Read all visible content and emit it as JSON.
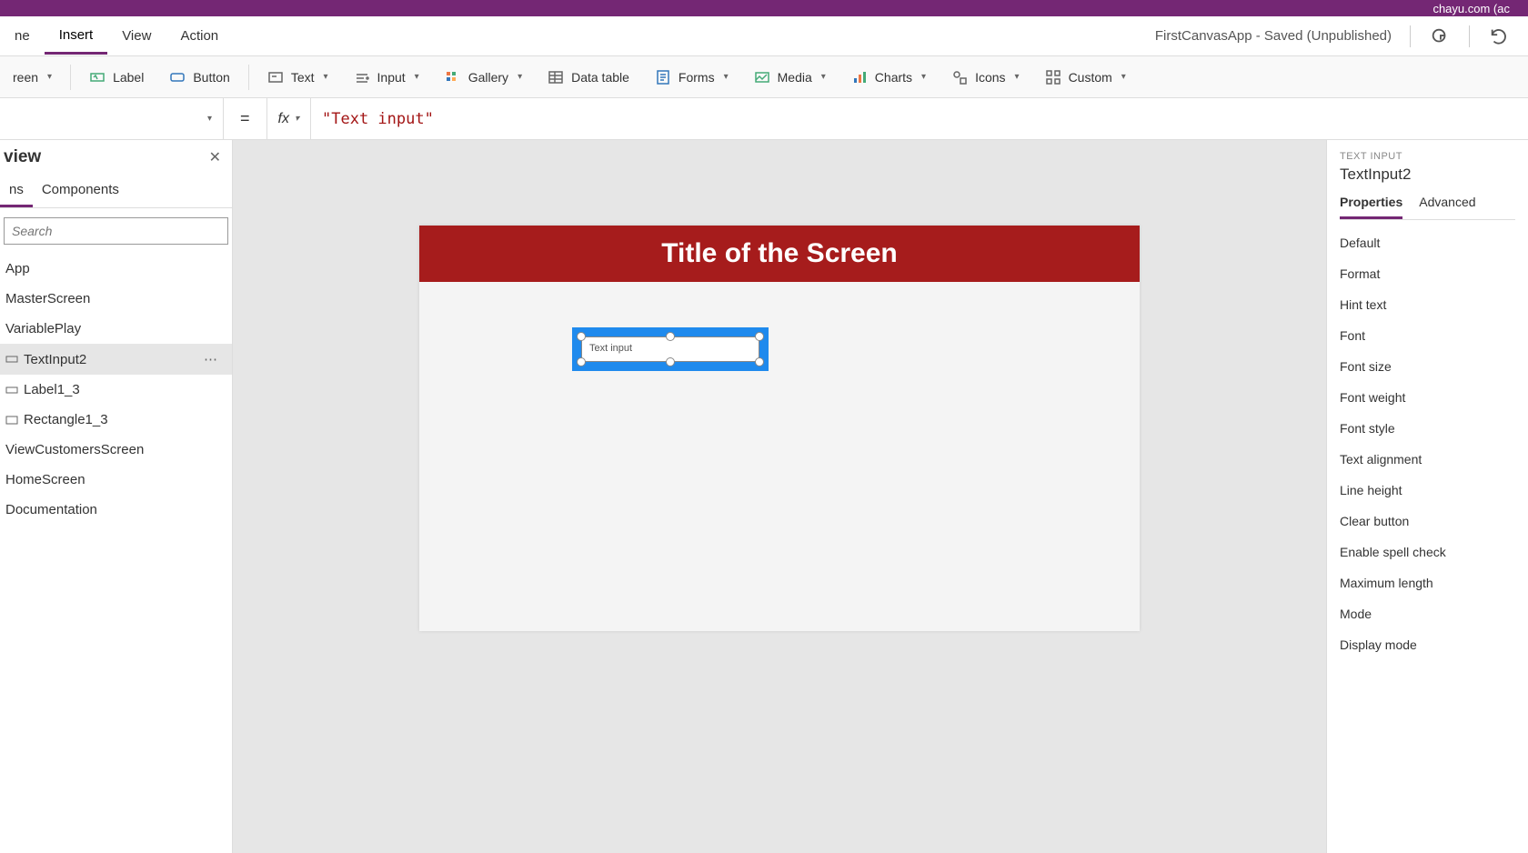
{
  "title_bar": {
    "user_text": "chayu.com (ac"
  },
  "menu": {
    "items": [
      "ne",
      "Insert",
      "View",
      "Action"
    ],
    "active_index": 1,
    "status": "FirstCanvasApp - Saved (Unpublished)"
  },
  "ribbon": {
    "screen": "reen",
    "label": "Label",
    "button": "Button",
    "text": "Text",
    "input": "Input",
    "gallery": "Gallery",
    "datatable": "Data table",
    "forms": "Forms",
    "media": "Media",
    "charts": "Charts",
    "icons": "Icons",
    "custom": "Custom"
  },
  "formula": {
    "equals": "=",
    "fx": "fx",
    "value": "\"Text input\""
  },
  "tree": {
    "title": "view",
    "tabs": [
      "ns",
      "Components"
    ],
    "active_tab": 0,
    "search_placeholder": "Search",
    "items": [
      {
        "label": "App"
      },
      {
        "label": "MasterScreen"
      },
      {
        "label": "VariablePlay"
      },
      {
        "label": "TextInput2",
        "selected": true
      },
      {
        "label": "Label1_3"
      },
      {
        "label": "Rectangle1_3"
      },
      {
        "label": "ViewCustomersScreen"
      },
      {
        "label": "HomeScreen"
      },
      {
        "label": "Documentation"
      }
    ]
  },
  "canvas": {
    "screen_title": "Title of the Screen",
    "control_text": "Text input"
  },
  "props": {
    "type": "TEXT INPUT",
    "name": "TextInput2",
    "tabs": [
      "Properties",
      "Advanced"
    ],
    "active_tab": 0,
    "list": [
      "Default",
      "Format",
      "Hint text",
      "Font",
      "Font size",
      "Font weight",
      "Font style",
      "Text alignment",
      "Line height",
      "Clear button",
      "Enable spell check",
      "Maximum length",
      "Mode",
      "Display mode"
    ]
  }
}
